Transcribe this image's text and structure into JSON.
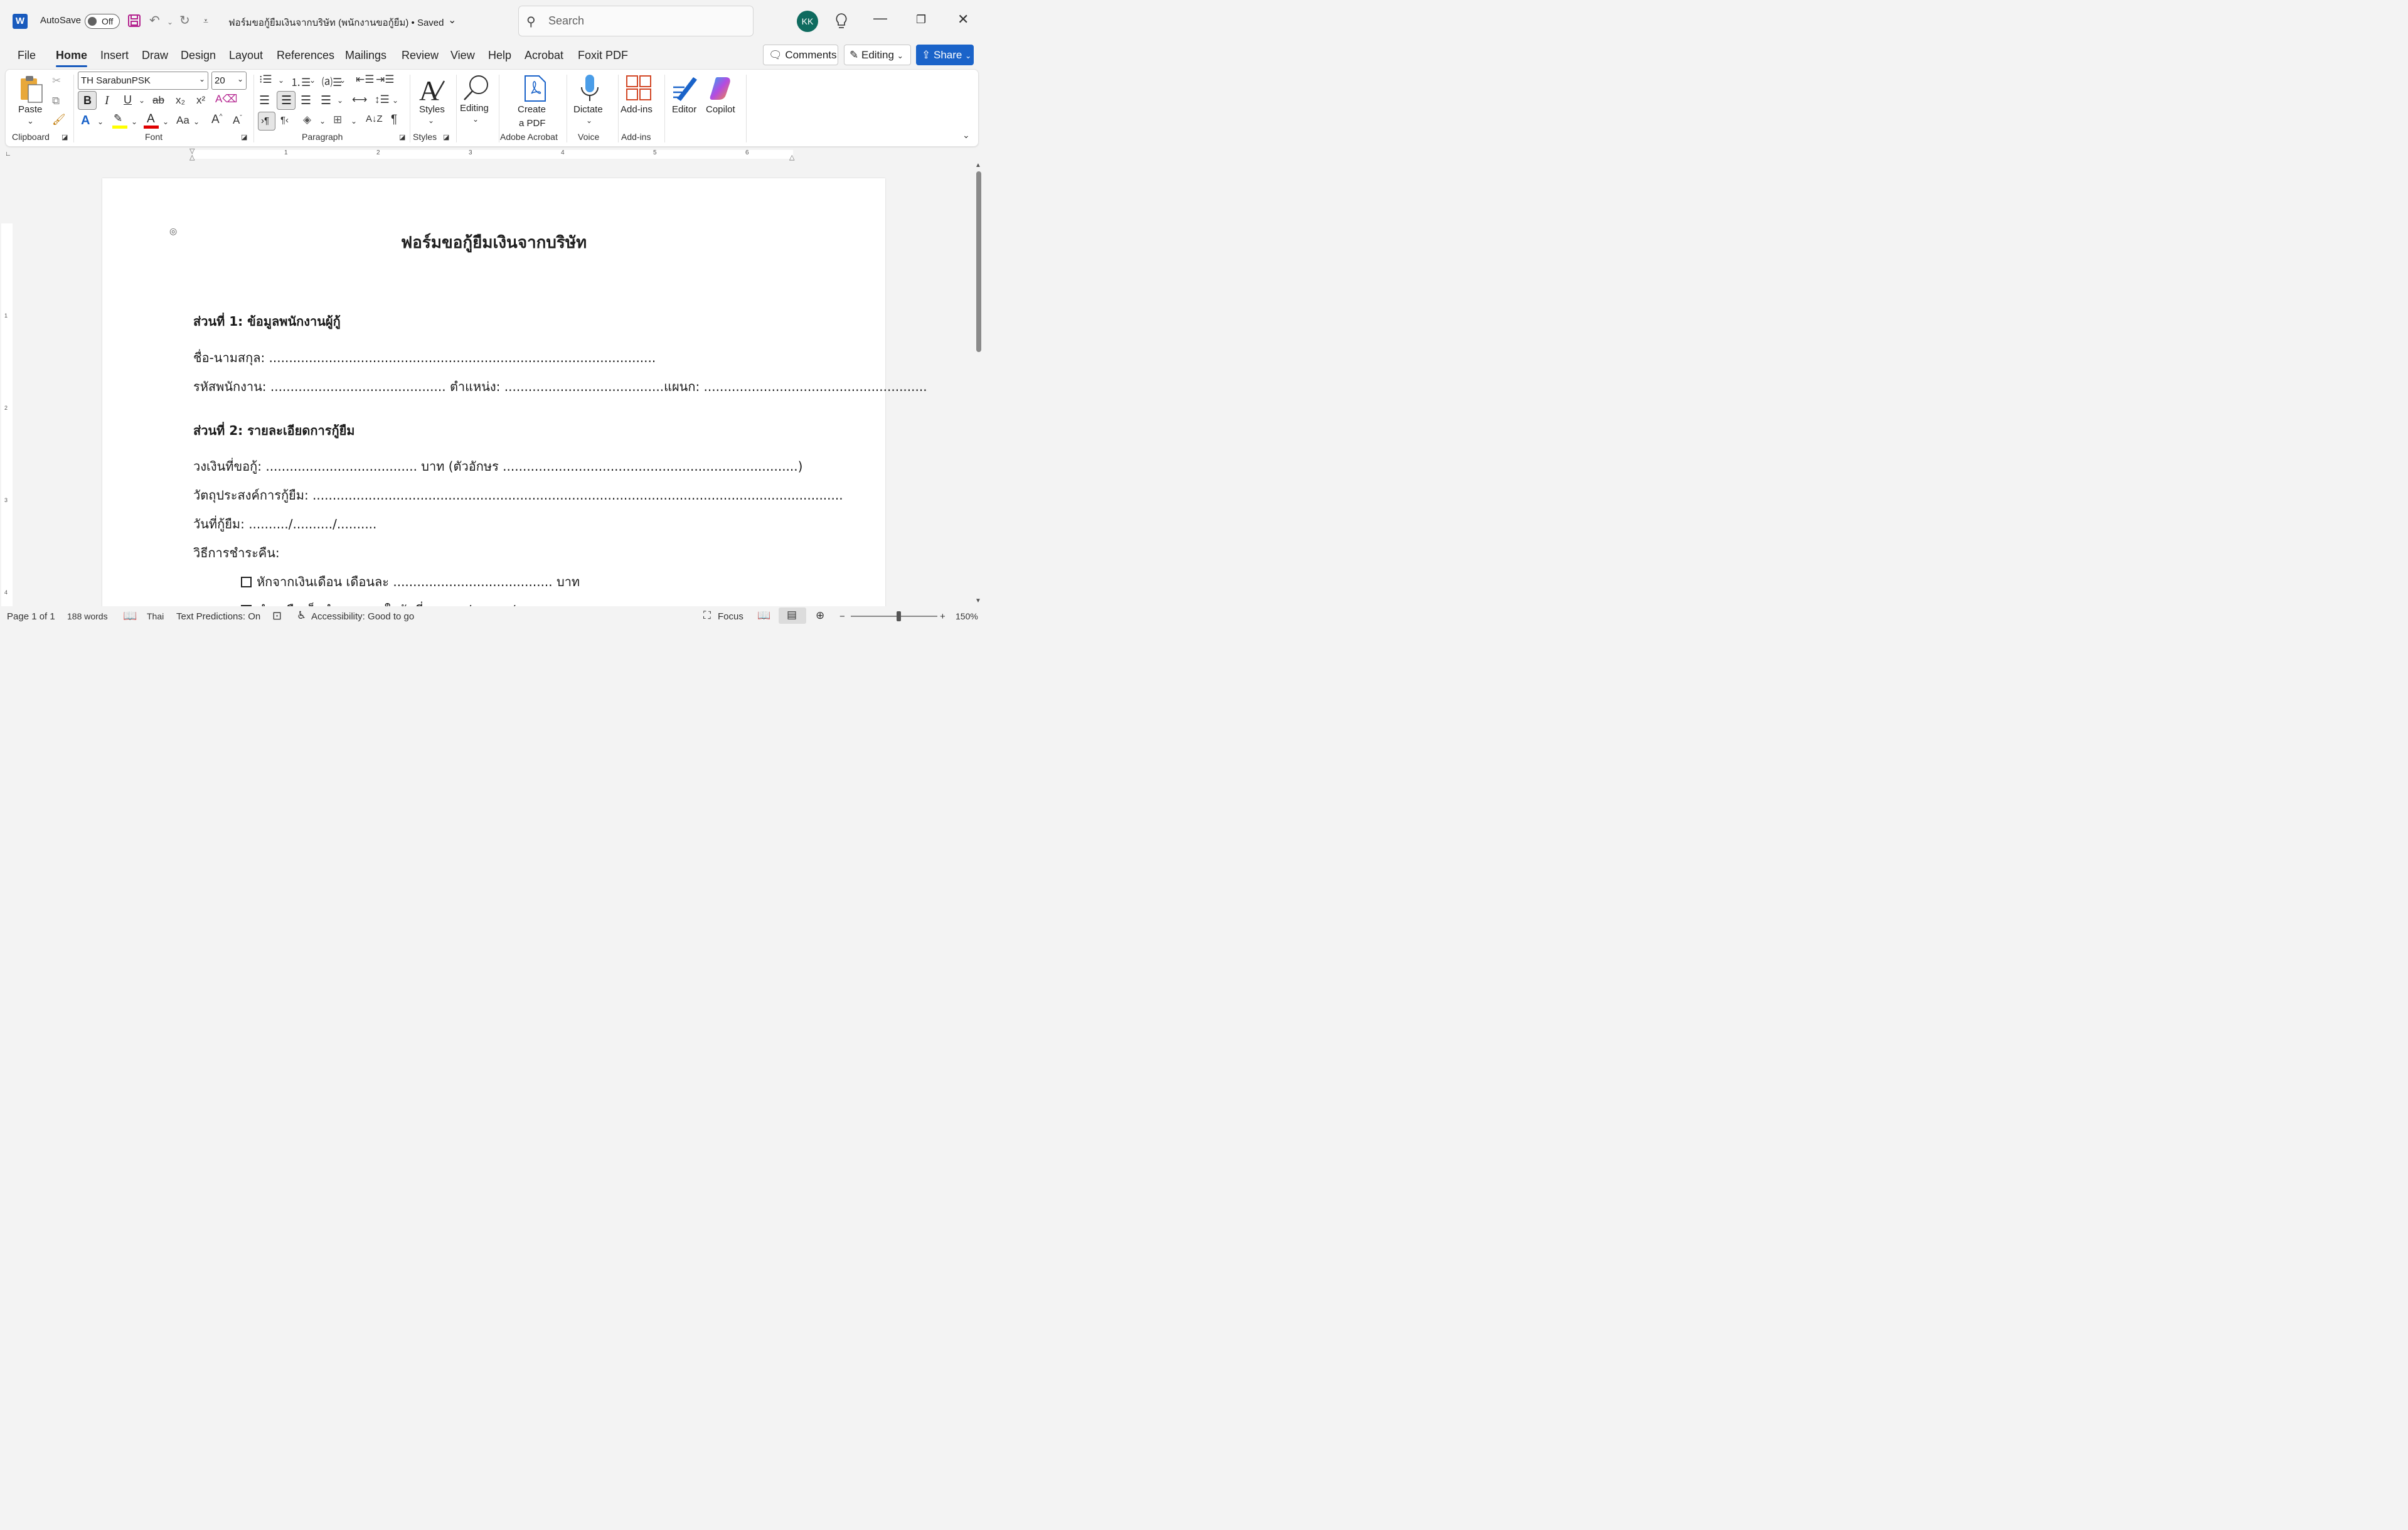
{
  "titlebar": {
    "app_logo": "W",
    "autosave_label": "AutoSave",
    "autosave_state": "Off",
    "doc_title": "ฟอร์มขอกู้ยืมเงินจากบริษัท (พนักงานขอกู้ยืม) • Saved",
    "search_placeholder": "Search",
    "avatar_initials": "KK"
  },
  "menu": {
    "items": [
      "File",
      "Home",
      "Insert",
      "Draw",
      "Design",
      "Layout",
      "References",
      "Mailings",
      "Review",
      "View",
      "Help",
      "Acrobat",
      "Foxit PDF"
    ],
    "active": "Home",
    "comments": "Comments",
    "editing": "Editing",
    "share": "Share"
  },
  "ribbon": {
    "clipboard": {
      "paste": "Paste",
      "group": "Clipboard"
    },
    "font": {
      "name": "TH SarabunPSK",
      "size": "20",
      "group": "Font",
      "bold": "B",
      "italic": "I",
      "underline": "U",
      "strike": "ab",
      "change_case": "Aa"
    },
    "paragraph": {
      "group": "Paragraph"
    },
    "styles": {
      "label": "Styles",
      "group": "Styles"
    },
    "editing": {
      "label": "Editing"
    },
    "acrobat": {
      "create_line1": "Create",
      "create_line2": "a PDF",
      "group": "Adobe Acrobat"
    },
    "voice": {
      "dictate": "Dictate",
      "group": "Voice"
    },
    "addins": {
      "label": "Add-ins",
      "group": "Add-ins"
    },
    "editor": "Editor",
    "copilot": "Copilot"
  },
  "ruler": {
    "numbers": [
      "1",
      "2",
      "3",
      "4",
      "5",
      "6"
    ],
    "vnumbers": [
      "1",
      "2",
      "3",
      "4"
    ]
  },
  "document": {
    "title": "ฟอร์มขอกู้ยืมเงินจากบริษัท",
    "s1_heading": "ส่วนที่ 1: ข้อมูลพนักงานผู้กู้",
    "name_line": "ชื่อ-นามสกุล: .................................................................................................",
    "id_line": "รหัสพนักงาน: ............................................ ตำแหน่ง: ........................................แผนก: ........................................................",
    "s2_heading": "ส่วนที่ 2: รายละเอียดการกู้ยืม",
    "amount_line": "วงเงินที่ขอกู้: ...................................... บาท (ตัวอักษร ..........................................................................)",
    "purpose_line": "วัตถุประสงค์การกู้ยืม: .....................................................................................................................................",
    "date_line": "วันที่กู้ยืม: ........../........../..........",
    "repay_label": "วิธีการชำระคืน:",
    "option1": "หักจากเงินเดือน เดือนละ ........................................ บาท",
    "option2": "ชำระคืนเต็มจำนวนภายในวันที่ ........../........../"
  },
  "status": {
    "page": "Page 1 of 1",
    "words": "188 words",
    "language": "Thai",
    "predictions": "Text Predictions: On",
    "accessibility": "Accessibility: Good to go",
    "focus": "Focus",
    "zoom": "150%"
  },
  "colors": {
    "accent": "#185abd",
    "share": "#1a63c9",
    "avatar": "#0f6b5f",
    "highlight": "#ffff00",
    "font_color": "#e00000"
  }
}
